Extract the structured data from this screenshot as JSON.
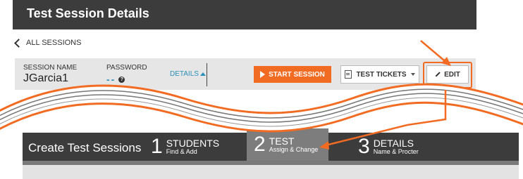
{
  "banner": {
    "title": "Test Session Details"
  },
  "nav": {
    "back_label": "ALL SESSIONS"
  },
  "session": {
    "name_label": "SESSION NAME",
    "name_value": "JGarcia1",
    "password_label": "PASSWORD",
    "password_value": "--",
    "details_label": "DETAILS",
    "start_label": "START SESSION",
    "tickets_label": "TEST TICKETS",
    "edit_label": "EDIT"
  },
  "create": {
    "title": "Create Test Sessions",
    "steps": [
      {
        "num": "1",
        "title": "STUDENTS",
        "sub": "Find & Add"
      },
      {
        "num": "2",
        "title": "TEST",
        "sub": "Assign & Change"
      },
      {
        "num": "3",
        "title": "DETAILS",
        "sub": "Name & Procter"
      }
    ]
  },
  "colors": {
    "accent": "#f26b22",
    "link": "#2a8fb9",
    "dark": "#3c3c3c"
  }
}
